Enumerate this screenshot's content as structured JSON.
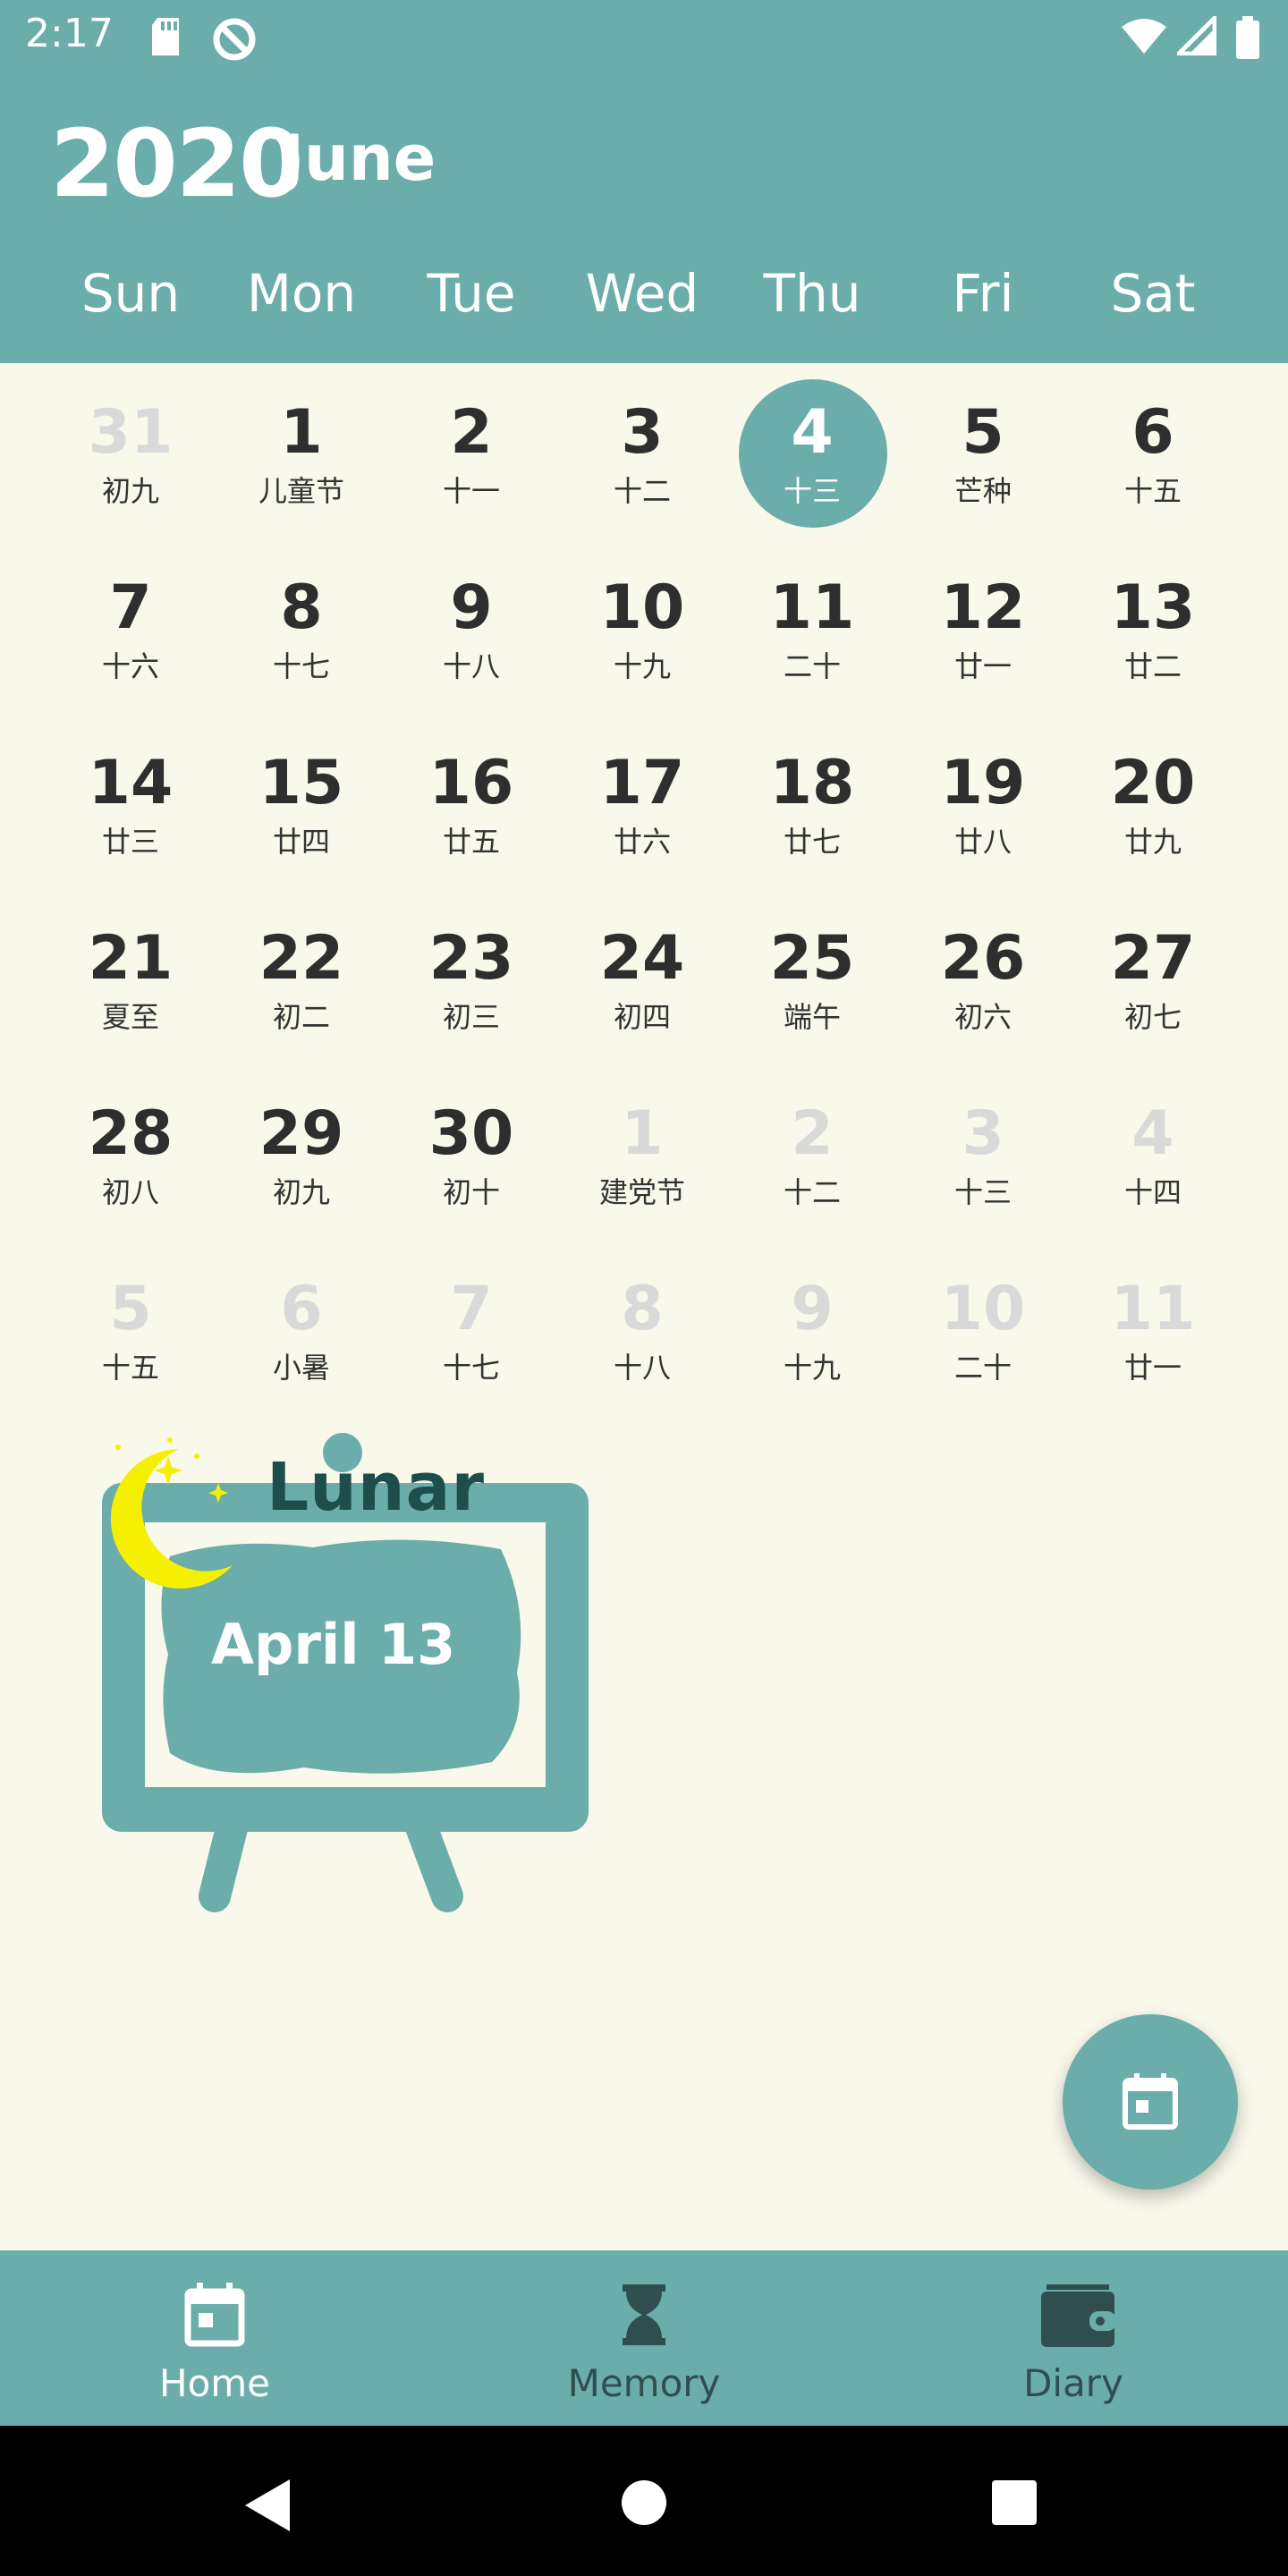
{
  "status": {
    "time": "2:17"
  },
  "header": {
    "year": "2020",
    "month": "June"
  },
  "weekdays": [
    "Sun",
    "Mon",
    "Tue",
    "Wed",
    "Thu",
    "Fri",
    "Sat"
  ],
  "calendar": {
    "rows": [
      [
        {
          "d": "31",
          "l": "初九",
          "other": true
        },
        {
          "d": "1",
          "l": "儿童节"
        },
        {
          "d": "2",
          "l": "十一"
        },
        {
          "d": "3",
          "l": "十二"
        },
        {
          "d": "4",
          "l": "十三",
          "today": true
        },
        {
          "d": "5",
          "l": "芒种"
        },
        {
          "d": "6",
          "l": "十五"
        }
      ],
      [
        {
          "d": "7",
          "l": "十六"
        },
        {
          "d": "8",
          "l": "十七"
        },
        {
          "d": "9",
          "l": "十八"
        },
        {
          "d": "10",
          "l": "十九"
        },
        {
          "d": "11",
          "l": "二十"
        },
        {
          "d": "12",
          "l": "廿一"
        },
        {
          "d": "13",
          "l": "廿二"
        }
      ],
      [
        {
          "d": "14",
          "l": "廿三"
        },
        {
          "d": "15",
          "l": "廿四"
        },
        {
          "d": "16",
          "l": "廿五"
        },
        {
          "d": "17",
          "l": "廿六"
        },
        {
          "d": "18",
          "l": "廿七"
        },
        {
          "d": "19",
          "l": "廿八"
        },
        {
          "d": "20",
          "l": "廿九"
        }
      ],
      [
        {
          "d": "21",
          "l": "夏至"
        },
        {
          "d": "22",
          "l": "初二"
        },
        {
          "d": "23",
          "l": "初三"
        },
        {
          "d": "24",
          "l": "初四"
        },
        {
          "d": "25",
          "l": "端午"
        },
        {
          "d": "26",
          "l": "初六"
        },
        {
          "d": "27",
          "l": "初七"
        }
      ],
      [
        {
          "d": "28",
          "l": "初八"
        },
        {
          "d": "29",
          "l": "初九"
        },
        {
          "d": "30",
          "l": "初十"
        },
        {
          "d": "1",
          "l": "建党节",
          "other": true
        },
        {
          "d": "2",
          "l": "十二",
          "other": true
        },
        {
          "d": "3",
          "l": "十三",
          "other": true
        },
        {
          "d": "4",
          "l": "十四",
          "other": true
        }
      ],
      [
        {
          "d": "5",
          "l": "十五",
          "other": true
        },
        {
          "d": "6",
          "l": "小暑",
          "other": true
        },
        {
          "d": "7",
          "l": "十七",
          "other": true
        },
        {
          "d": "8",
          "l": "十八",
          "other": true
        },
        {
          "d": "9",
          "l": "十九",
          "other": true
        },
        {
          "d": "10",
          "l": "二十",
          "other": true
        },
        {
          "d": "11",
          "l": "廿一",
          "other": true
        }
      ]
    ]
  },
  "lunar_board": {
    "title": "Lunar",
    "date": "April 13"
  },
  "nav": {
    "items": [
      {
        "label": "Home",
        "icon": "calendar-icon",
        "active": true
      },
      {
        "label": "Memory",
        "icon": "hourglass-icon",
        "active": false
      },
      {
        "label": "Diary",
        "icon": "wallet-icon",
        "active": false
      }
    ]
  },
  "colors": {
    "primary": "#6badaa",
    "background": "#f8f8eb",
    "moon": "#f5f000",
    "title": "#1e4e4c"
  }
}
